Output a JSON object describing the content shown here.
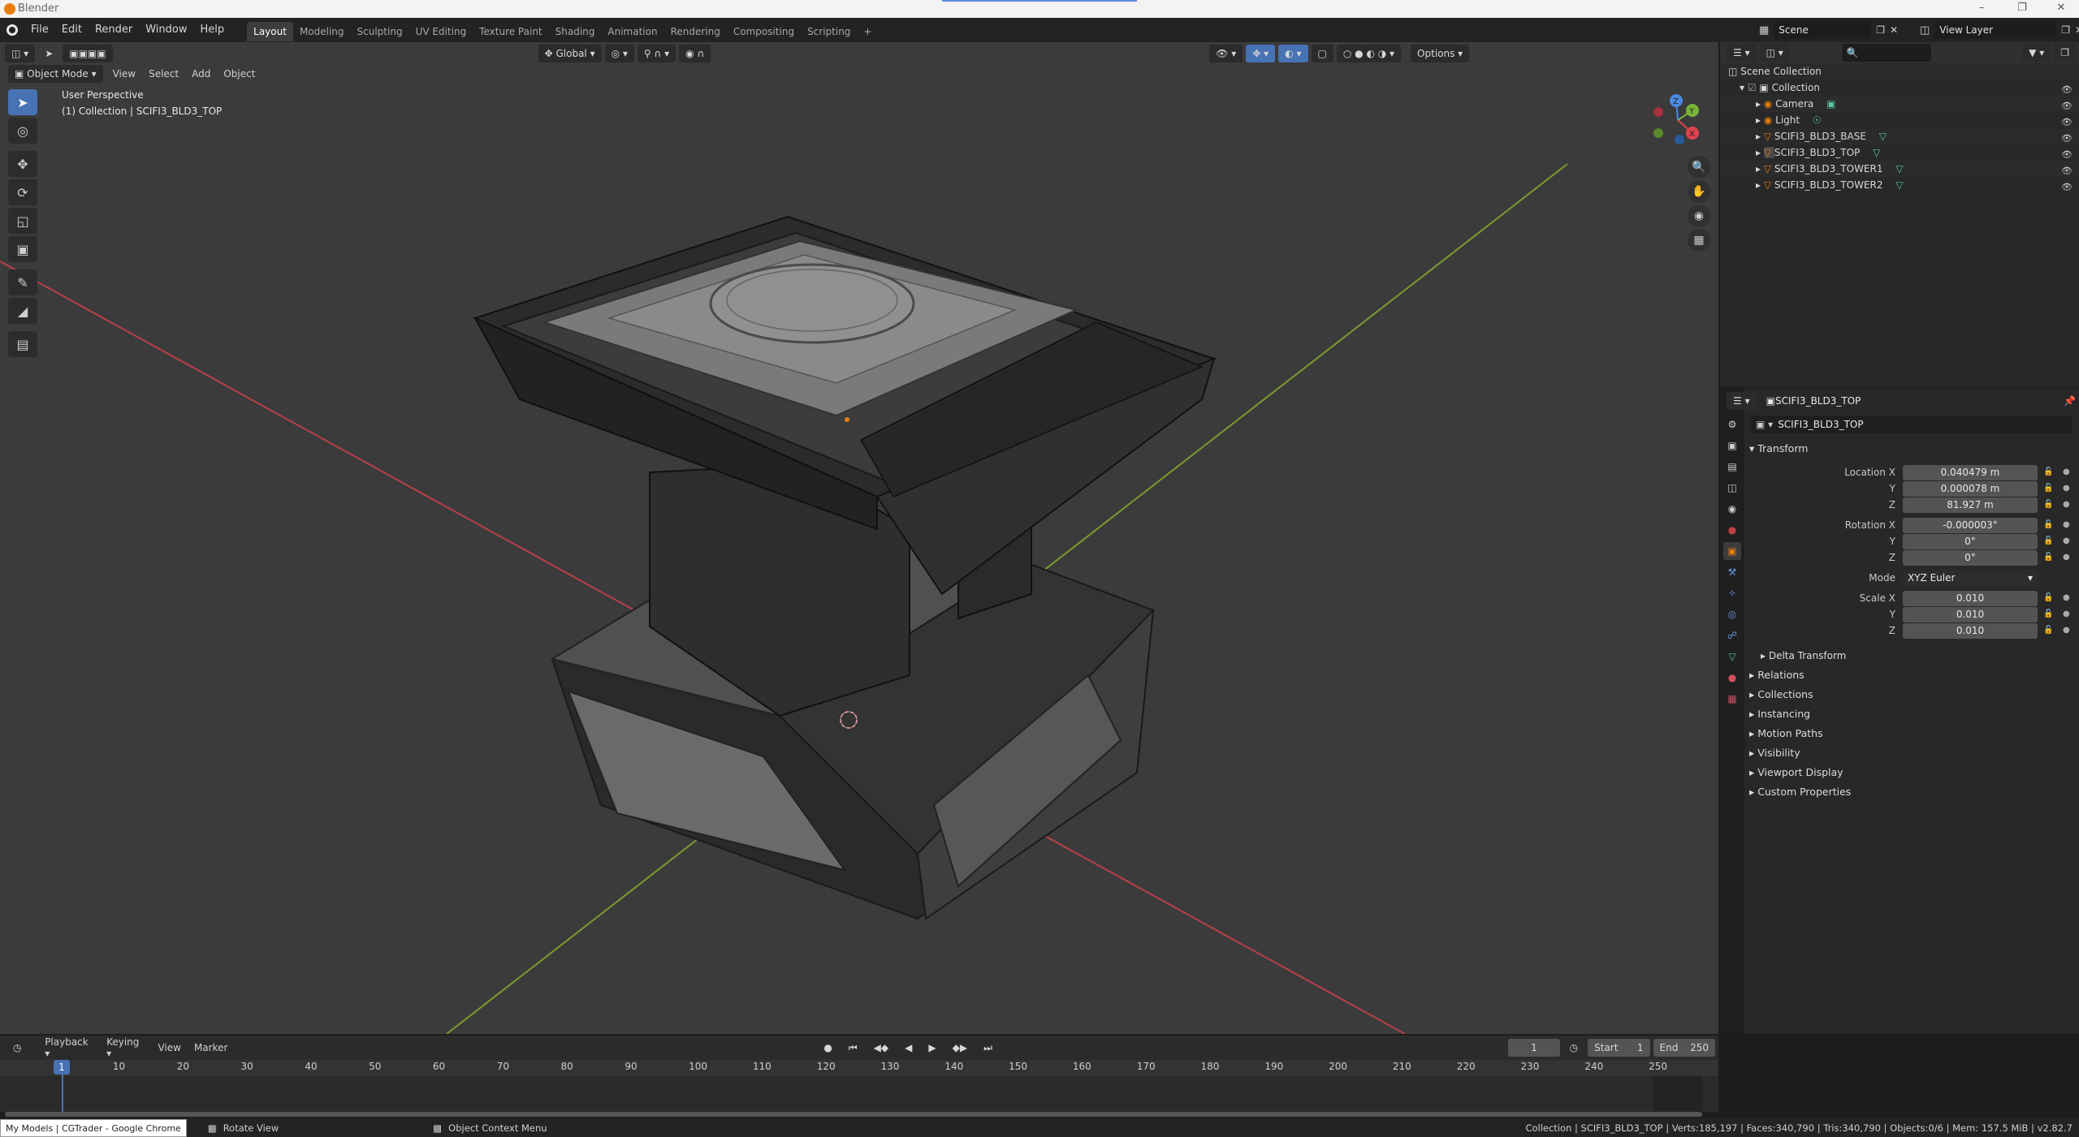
{
  "window": {
    "title": "Blender"
  },
  "menu": [
    "File",
    "Edit",
    "Render",
    "Window",
    "Help"
  ],
  "workspaces": [
    "Layout",
    "Modeling",
    "Sculpting",
    "UV Editing",
    "Texture Paint",
    "Shading",
    "Animation",
    "Rendering",
    "Compositing",
    "Scripting"
  ],
  "active_workspace": "Layout",
  "scene": {
    "name": "Scene",
    "view_layer": "View Layer"
  },
  "viewport": {
    "mode": "Object Mode",
    "menus": [
      "View",
      "Select",
      "Add",
      "Object"
    ],
    "transform_orientation": "Global",
    "options_label": "Options",
    "info_line1": "User Perspective",
    "info_line2": "(1) Collection | SCIFI3_BLD3_TOP",
    "gizmo_axes": [
      "X",
      "Y",
      "Z"
    ]
  },
  "outliner": {
    "root": "Scene Collection",
    "collection": "Collection",
    "items": [
      {
        "name": "Camera",
        "type": "camera"
      },
      {
        "name": "Light",
        "type": "light"
      },
      {
        "name": "SCIFI3_BLD3_BASE",
        "type": "mesh"
      },
      {
        "name": "SCIFI3_BLD3_TOP",
        "type": "mesh"
      },
      {
        "name": "SCIFI3_BLD3_TOWER1",
        "type": "mesh"
      },
      {
        "name": "SCIFI3_BLD3_TOWER2",
        "type": "mesh"
      }
    ]
  },
  "properties": {
    "object_name": "SCIFI3_BLD3_TOP",
    "object_name_field": "SCIFI3_BLD3_TOP",
    "transform_title": "Transform",
    "location": {
      "label": "Location X",
      "x": "0.040479 m",
      "y": "0.000078 m",
      "z": "81.927 m"
    },
    "rotation": {
      "label": "Rotation X",
      "x": "-0.000003°",
      "y": "0°",
      "z": "0°"
    },
    "mode_label": "Mode",
    "mode": "XYZ Euler",
    "scale": {
      "label": "Scale X",
      "x": "0.010",
      "y": "0.010",
      "z": "0.010"
    },
    "axis_y": "Y",
    "axis_z": "Z",
    "delta_transform": "Delta Transform",
    "panels": [
      "Relations",
      "Collections",
      "Instancing",
      "Motion Paths",
      "Visibility",
      "Viewport Display",
      "Custom Properties"
    ]
  },
  "timeline": {
    "menus": [
      "Playback",
      "Keying",
      "View",
      "Marker"
    ],
    "current_frame": "1",
    "start_label": "Start",
    "start": "1",
    "end_label": "End",
    "end": "250",
    "ticks": [
      "10",
      "20",
      "30",
      "40",
      "50",
      "60",
      "70",
      "80",
      "90",
      "100",
      "110",
      "120",
      "130",
      "140",
      "150",
      "160",
      "170",
      "180",
      "190",
      "200",
      "210",
      "220",
      "230",
      "240",
      "250"
    ],
    "playhead": "1"
  },
  "statusbar": {
    "taskbar_app": "My Models | CGTrader - Google Chrome",
    "hint_rotate": "Rotate View",
    "hint_context": "Object Context Menu",
    "stats": "Collection | SCIFI3_BLD3_TOP | Verts:185,197 | Faces:340,790 | Tris:340,790 | Objects:0/6 | Mem: 157.5 MiB | v2.82.7"
  },
  "colors": {
    "accent": "#4772b3",
    "axis_x": "#e04050",
    "axis_y": "#7ab33a",
    "axis_z": "#4a8be0",
    "mesh_icon": "#5ec6a8"
  }
}
